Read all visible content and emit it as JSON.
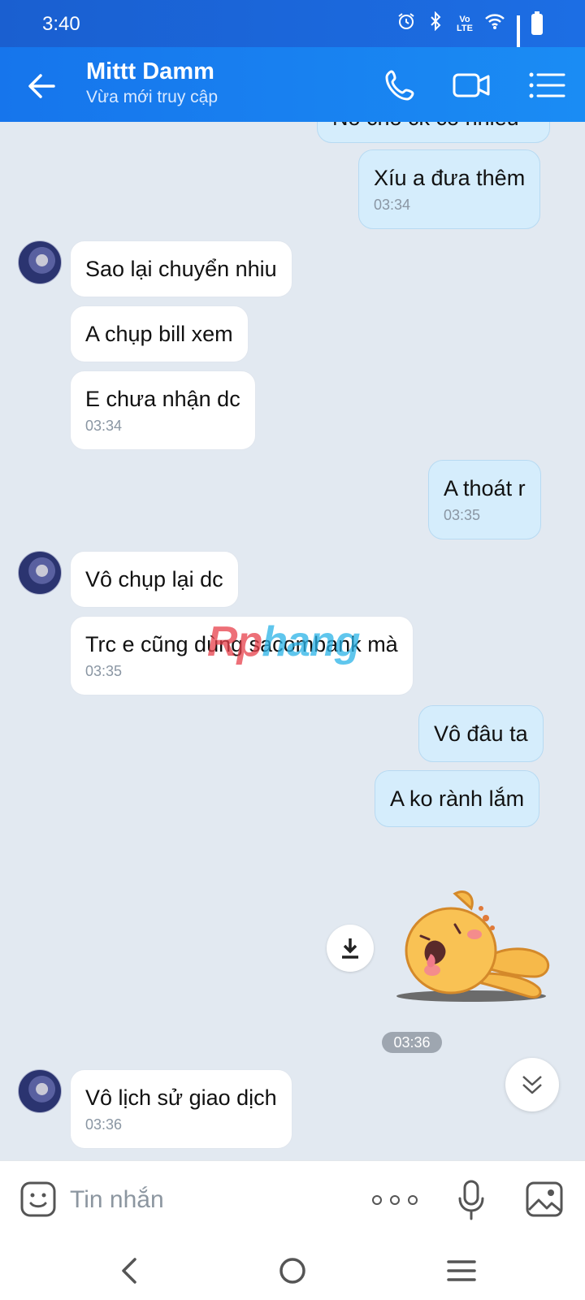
{
  "status_bar": {
    "time": "3:40"
  },
  "header": {
    "name": "Mittt Damm",
    "status": "Vừa mới truy cập"
  },
  "messages": [
    {
      "text": "Nó cho ck có nhiều",
      "time": ""
    },
    {
      "text": "Xíu a đưa thêm",
      "time": "03:34"
    },
    {
      "text": "Sao lại chuyển nhiu",
      "time": ""
    },
    {
      "text": "A chụp bill xem",
      "time": ""
    },
    {
      "text": "E chưa nhận dc",
      "time": "03:34"
    },
    {
      "text": "A thoát r",
      "time": "03:35"
    },
    {
      "text": "Vô chụp lại dc",
      "time": ""
    },
    {
      "text": "Trc e cũng dùng sacombank mà",
      "time": "03:35"
    },
    {
      "text": "Vô đâu ta",
      "time": ""
    },
    {
      "text": "A ko rành lắm",
      "time": ""
    },
    {
      "text": "Vô lịch sử giao dịch",
      "time": "03:36"
    }
  ],
  "sticker": {
    "time": "03:36",
    "icon": "sleeping-bunny-sticker"
  },
  "watermark": {
    "part1": "Rp",
    "part2": "hang"
  },
  "input": {
    "placeholder": "Tin nhắn"
  }
}
